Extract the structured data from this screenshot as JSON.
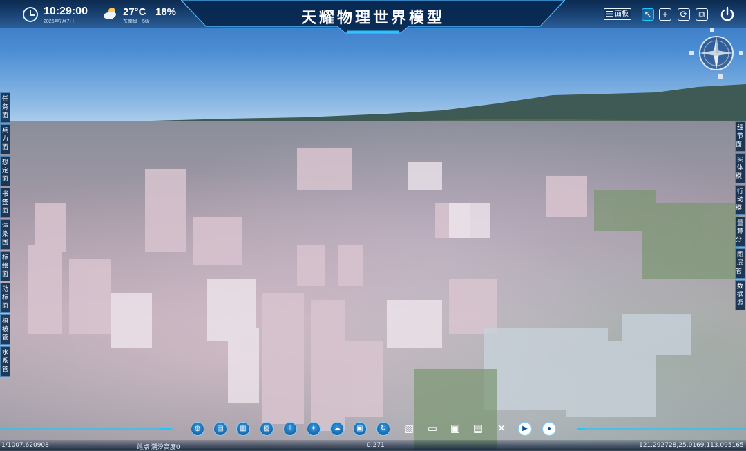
{
  "header": {
    "title": "天耀物理世界模型",
    "time": "10:29:00",
    "date": "2026年7月7日",
    "temperature": "27°C",
    "humidity": "18%",
    "wind_direction": "东南风",
    "wind_level": "5级",
    "panel_button_label": "面板"
  },
  "toolbar_right_icons": [
    "select-icon",
    "add-icon",
    "refresh-icon",
    "fullscreen-icon",
    "power-icon"
  ],
  "left_tabs": [
    "任务面",
    "兵力面",
    "想定面",
    "书签面",
    "渲染国",
    "标绘面",
    "动标面",
    "植被管",
    "水系管"
  ],
  "right_tabs": [
    "细节面…",
    "实体模…",
    "行动模…",
    "量算分…",
    "图层管…",
    "数据源"
  ],
  "bottom_tools": [
    "globe-icon",
    "map-icon",
    "building-icon",
    "terrain-icon",
    "tower-icon",
    "satellite-icon",
    "cloud-icon",
    "save-icon",
    "rotate-icon",
    "export-icon",
    "folder-icon",
    "save-as-icon",
    "save-copy-icon",
    "close-icon",
    "play-icon",
    "record-icon"
  ],
  "status": {
    "scale": "1/1007.620908",
    "elevation_label": "站点 潮汐高度0",
    "zoom": "0.271",
    "coordinates": "121.292728,25.0169,113.095165"
  },
  "colors": {
    "panel_bg": "#0a284b",
    "accent": "#3a9be0",
    "highlight": "#1ec8ff"
  }
}
